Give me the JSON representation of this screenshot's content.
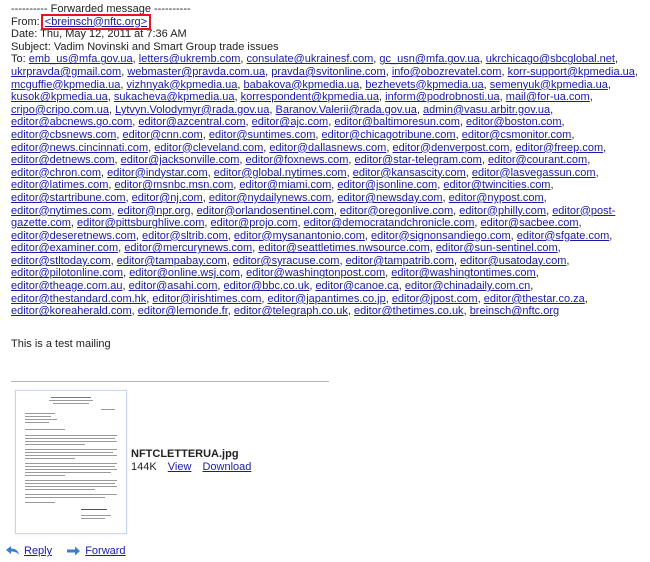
{
  "forwarded_header": "---------- Forwarded message ----------",
  "from": {
    "label": "From:",
    "value": "<breinsch@nftc.org>"
  },
  "date": {
    "label": "Date:",
    "value": "Thu, May 12, 2011 at 7:36 AM"
  },
  "subject": {
    "label": "Subject:",
    "value": "Vadim Novinski and Smart Group trade issues"
  },
  "to": {
    "label": "To:",
    "recipients": [
      "emb_us@mfa.gov.ua",
      "letters@ukremb.com",
      "consulate@ukrainesf.com",
      "gc_usn@mfa.gov.ua",
      "ukrchicago@sbcglobal.net",
      "ukrpravda@gmail.com",
      "webmaster@pravda.com.ua",
      "pravda@svitonline.com",
      "info@obozrevatel.com",
      "korr-support@kpmedia.ua",
      "mcguffie@kpmedia.ua",
      "vizhnyak@kpmedia.ua",
      "babakova@kpmedia.ua",
      "bezhevets@kpmedia.ua",
      "semenyuk@kpmedia.ua",
      "kusok@kpmedia.ua",
      "sukacheva@kpmedia.ua",
      "korrespondent@kpmedia.ua",
      "inform@podrobnosti.ua",
      "mail@for-ua.com",
      "cripo@cripo.com.ua",
      "Lytvyn.Volodymyr@rada.gov.ua",
      "Baranov.Valerii@rada.gov.ua",
      "admin@vasu.arbitr.gov.ua",
      "editor@abcnews.go.com",
      "editor@azcentral.com",
      "editor@ajc.com",
      "editor@baltimoresun.com",
      "editor@boston.com",
      "editor@cbsnews.com",
      "editor@cnn.com",
      "editor@suntimes.com",
      "editor@chicagotribune.com",
      "editor@csmonitor.com",
      "editor@news.cincinnati.com",
      "editor@cleveland.com",
      "editor@dallasnews.com",
      "editor@denverpost.com",
      "editor@freep.com",
      "editor@detnews.com",
      "editor@jacksonville.com",
      "editor@foxnews.com",
      "editor@star-telegram.com",
      "editor@courant.com",
      "editor@chron.com",
      "editor@indystar.com",
      "editor@global.nytimes.com",
      "editor@kansascity.com",
      "editor@lasvegassun.com",
      "editor@latimes.com",
      "editor@msnbc.msn.com",
      "editor@miami.com",
      "editor@jsonline.com",
      "editor@twincities.com",
      "editor@startribune.com",
      "editor@nj.com",
      "editor@nydailynews.com",
      "editor@newsday.com",
      "editor@nypost.com",
      "editor@nytimes.com",
      "editor@npr.org",
      "editor@orlandosentinel.com",
      "editor@oregonlive.com",
      "editor@philly.com",
      "editor@post-gazette.com",
      "editor@pittsburghlive.com",
      "editor@projo.com",
      "editor@democratandchronicle.com",
      "editor@sacbee.com",
      "editor@deseretnews.com",
      "editor@sltrib.com",
      "editor@mysanantonio.com",
      "editor@signonsandiego.com",
      "editor@sfgate.com",
      "editor@examiner.com",
      "editor@mercurynews.com",
      "editor@seattletimes.nwsource.com",
      "editor@sun-sentinel.com",
      "editor@stltoday.com",
      "editor@tampabay.com",
      "editor@syracuse.com",
      "editor@tampatrib.com",
      "editor@usatoday.com",
      "editor@pilotonline.com",
      "editor@online.wsj.com",
      "editor@washingtonpost.com",
      "editor@washingtontimes.com",
      "editor@theage.com.au",
      "editor@asahi.com",
      "editor@bbc.co.uk",
      "editor@canoe.ca",
      "editor@chinadaily.com.cn",
      "editor@thestandard.com.hk",
      "editor@irishtimes.com",
      "editor@japantimes.co.jp",
      "editor@jpost.com",
      "editor@thestar.co.za",
      "editor@koreaherald.com",
      "editor@lemonde.fr",
      "editor@telegraph.co.uk",
      "editor@thetimes.co.uk",
      "breinsch@nftc.org"
    ]
  },
  "body_text": "This is a test mailing",
  "attachment": {
    "filename": "NFTCLETTERUA.jpg",
    "size": "144K",
    "view_label": "View",
    "download_label": "Download",
    "thumbnail_icon": "letter-document-thumbnail"
  },
  "actions": {
    "reply_label": "Reply",
    "forward_label": "Forward"
  },
  "colors": {
    "link": "#1a1aa6",
    "highlight_box": "#e8141c",
    "action_icon": "#3a7ed0"
  }
}
